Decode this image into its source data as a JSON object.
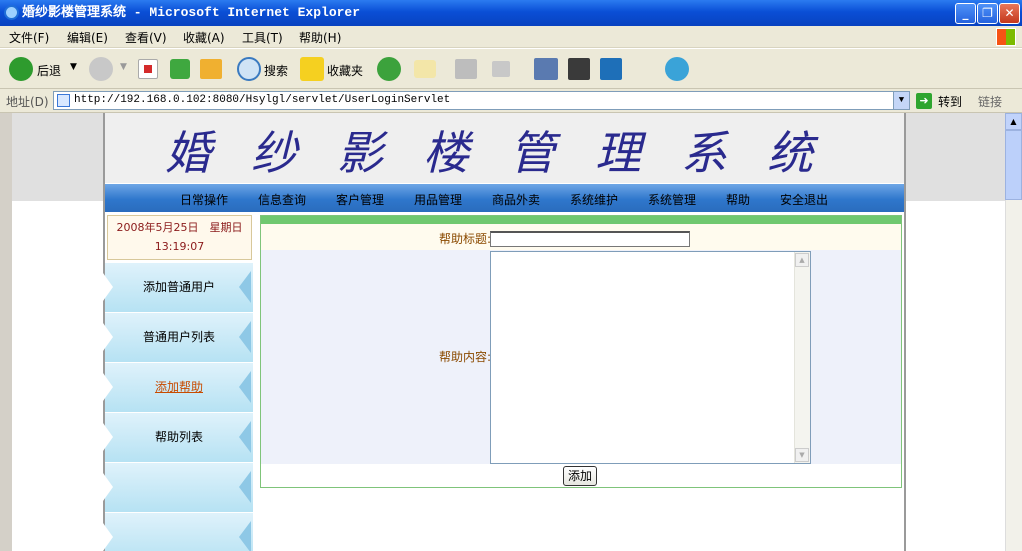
{
  "window": {
    "title": "婚纱影楼管理系统 - Microsoft Internet Explorer",
    "minimize": "_",
    "maximize": "❐",
    "close": "✕"
  },
  "menubar": [
    "文件(F)",
    "编辑(E)",
    "查看(V)",
    "收藏(A)",
    "工具(T)",
    "帮助(H)"
  ],
  "toolbar": {
    "back": "后退",
    "search": "搜索",
    "favorites": "收藏夹"
  },
  "address": {
    "label": "地址(D)",
    "url": "http://192.168.0.102:8080/Hsylgl/servlet/UserLoginServlet",
    "go": "转到",
    "links": "链接"
  },
  "app": {
    "title": "婚纱影楼管理系统",
    "nav": [
      "日常操作",
      "信息查询",
      "客户管理",
      "用品管理",
      "商品外卖",
      "系统维护",
      "系统管理",
      "帮助",
      "安全退出"
    ],
    "date": "2008年5月25日　星期日",
    "time": "13:19:07",
    "sidebar": [
      "添加普通用户",
      "普通用户列表",
      "添加帮助",
      "帮助列表",
      "",
      ""
    ],
    "form": {
      "title_label": "帮助标题:",
      "content_label": "帮助内容:",
      "title_value": "",
      "content_value": "",
      "submit": "添加"
    }
  },
  "colors": {
    "titlebar": "#0a4fd6",
    "banner_text": "#2a2a8e",
    "nav": "#2f77cc",
    "active_link": "#c84b00",
    "form_accent": "#6fc86f"
  }
}
